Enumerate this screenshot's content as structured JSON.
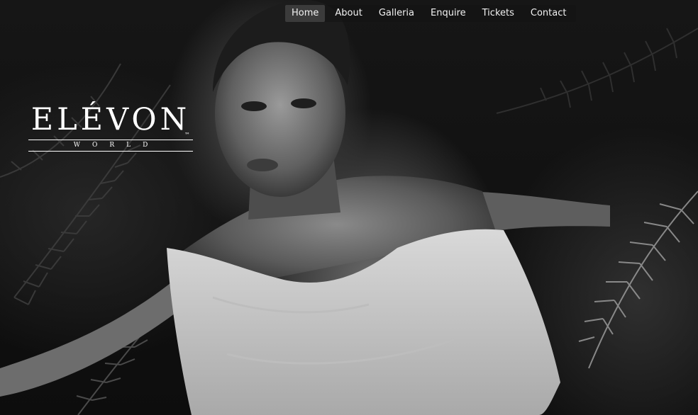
{
  "brand": {
    "name": "ELÉVON",
    "tagline": "WORLD",
    "trademark": "™"
  },
  "nav": {
    "items": [
      {
        "label": "Home",
        "active": true
      },
      {
        "label": "About",
        "active": false
      },
      {
        "label": "Galleria",
        "active": false
      },
      {
        "label": "Enquire",
        "active": false
      },
      {
        "label": "Tickets",
        "active": false
      },
      {
        "label": "Contact",
        "active": false
      }
    ]
  },
  "hero": {
    "image": "black-and-white-portrait-woman-ferns-icon",
    "tone": "monochrome"
  },
  "colors": {
    "nav_active_bg": "#3b3b3b",
    "text": "#f2f2f2",
    "background": "#0b0b0b"
  }
}
